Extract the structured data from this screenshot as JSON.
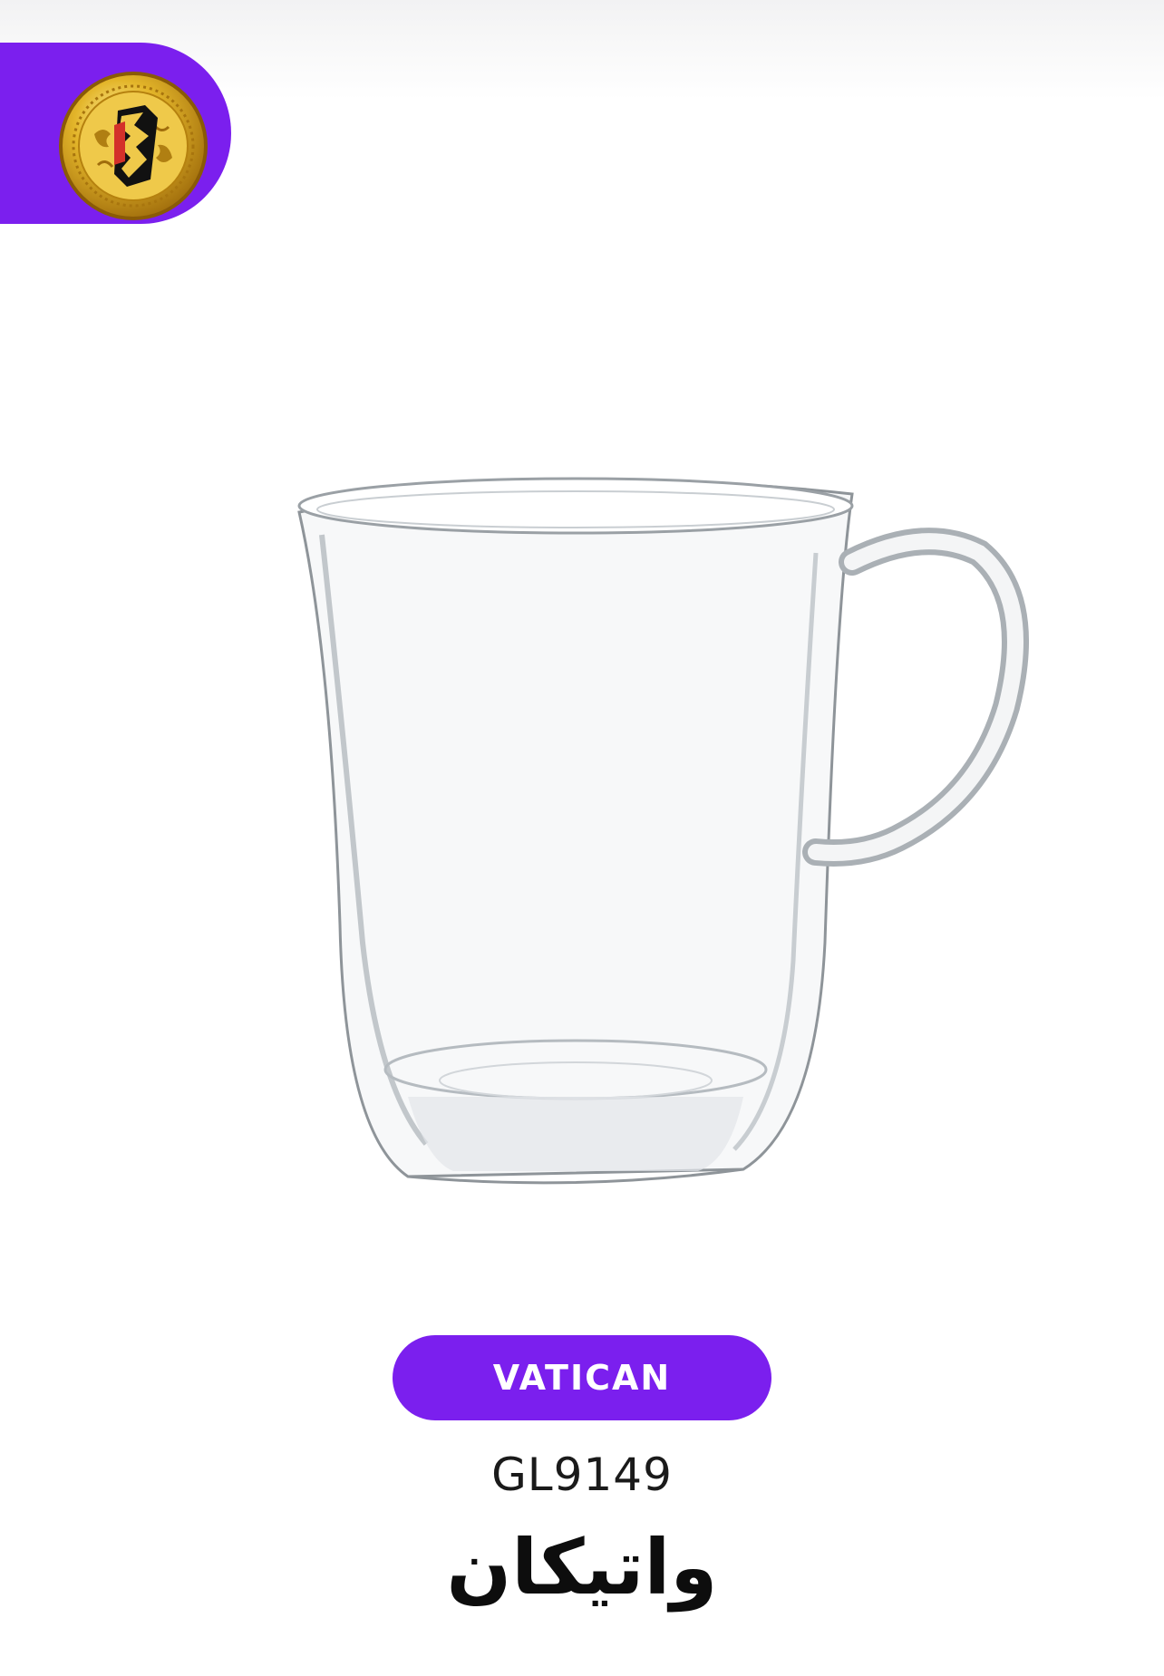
{
  "brand": {
    "color": "#7b1fee",
    "logo_icon": "gold-coin-logo"
  },
  "product": {
    "image_icon": "glass-mug",
    "name_en": "VATICAN",
    "code": "GL9149",
    "name_fa": "واتیکان"
  }
}
